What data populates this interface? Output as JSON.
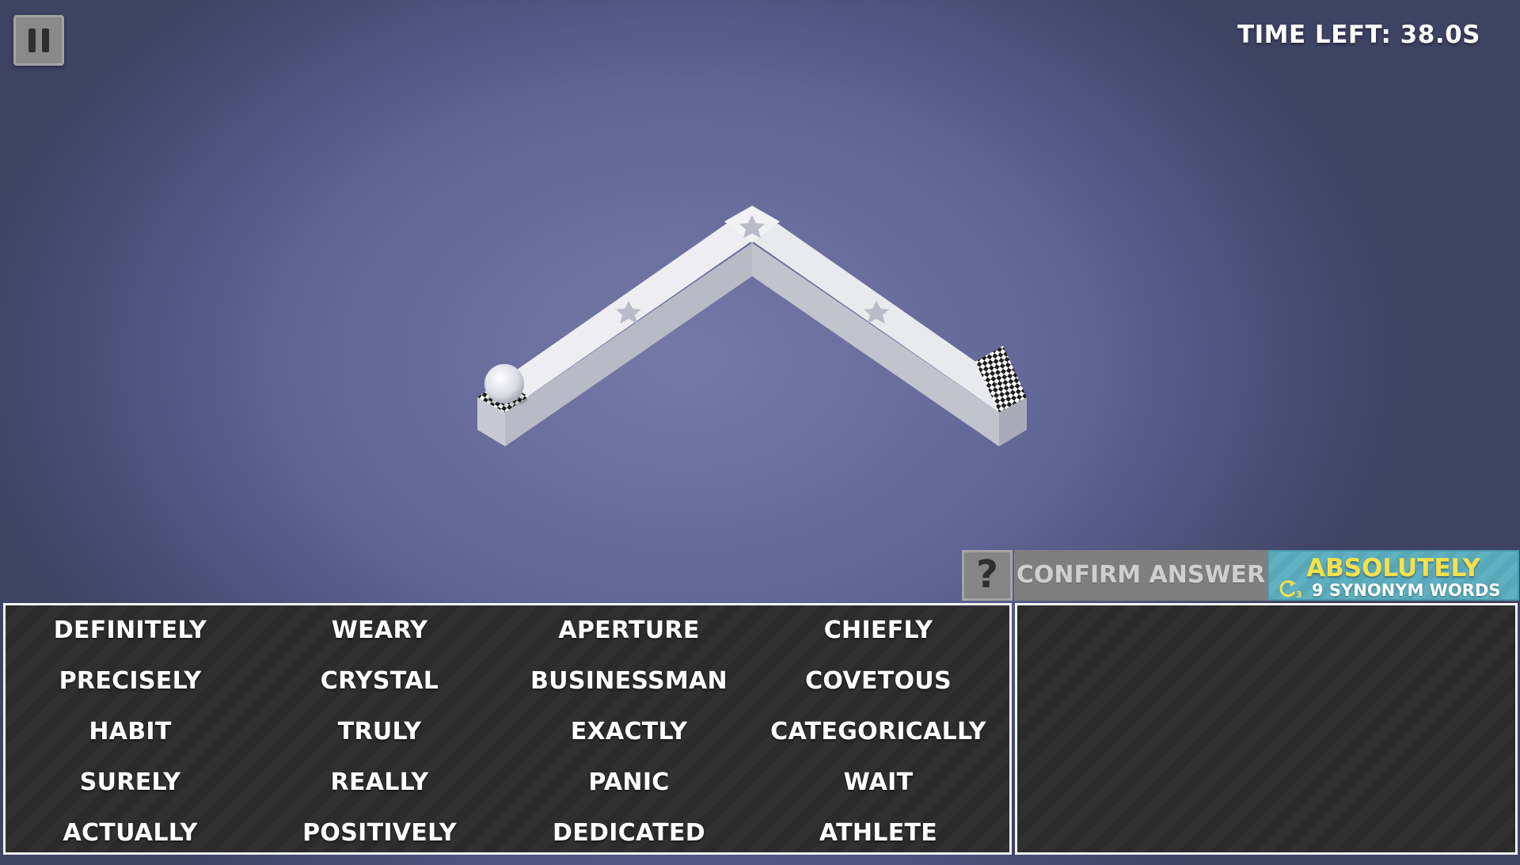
{
  "hud": {
    "timer_text": "TIME LEFT: 38.0S"
  },
  "controls": {
    "help_label": "?",
    "confirm_label": "CONFIRM ANSWER"
  },
  "target": {
    "word": "ABSOLUTELY",
    "subtitle": "9 SYNONYM WORDS",
    "cycle_number": "3"
  },
  "words": [
    [
      "DEFINITELY",
      "WEARY",
      "APERTURE",
      "CHIEFLY"
    ],
    [
      "PRECISELY",
      "CRYSTAL",
      "BUSINESSMAN",
      "COVETOUS"
    ],
    [
      "HABIT",
      "TRULY",
      "EXACTLY",
      "CATEGORICALLY"
    ],
    [
      "SURELY",
      "REALLY",
      "PANIC",
      "WAIT"
    ],
    [
      "ACTUALLY",
      "POSITIVELY",
      "DEDICATED",
      "ATHLETE"
    ]
  ],
  "colors": {
    "target_word": "#f7e04a",
    "target_bg": "#58a8b9",
    "panel_bg": "#2b2b2b"
  }
}
